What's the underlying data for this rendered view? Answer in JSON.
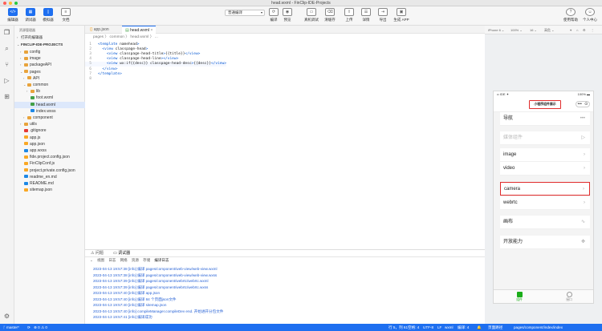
{
  "window": {
    "title": "head.wxml - FinClip-IDE-Projects"
  },
  "toolbar": {
    "left": [
      {
        "label": "编辑器",
        "icon": "code-icon"
      },
      {
        "label": "调试器",
        "icon": "debug-icon"
      },
      {
        "label": "模拟器",
        "icon": "phone-icon"
      },
      {
        "label": "文档",
        "icon": "doc-icon"
      }
    ],
    "compile_mode": "普通编译",
    "center": [
      {
        "label": "编译",
        "icon": "refresh-icon"
      },
      {
        "label": "预览",
        "icon": "eye-icon"
      }
    ],
    "right": [
      {
        "label": "真机调试",
        "icon": "device-icon"
      },
      {
        "label": "清缓存",
        "icon": "broom-icon"
      },
      {
        "label": "上传",
        "icon": "upload-icon"
      },
      {
        "label": "详情",
        "icon": "detail-icon"
      },
      {
        "label": "导出",
        "icon": "export-icon"
      },
      {
        "label": "生成 APP",
        "icon": "app-icon"
      }
    ],
    "help": [
      {
        "label": "使用帮助",
        "icon": "help-icon"
      },
      {
        "label": "个人中心",
        "icon": "user-icon"
      }
    ]
  },
  "explorer": {
    "title": "资源管理器",
    "open_editors": "打开的编辑器",
    "project": "FINCLIP-IDE-PROJECTS",
    "items": [
      {
        "label": "config",
        "type": "folder",
        "depth": 1,
        "chev": "›",
        "color": "#e8a33b"
      },
      {
        "label": "image",
        "type": "folder",
        "depth": 1,
        "chev": "›",
        "color": "#e8a33b"
      },
      {
        "label": "packageAPI",
        "type": "folder",
        "depth": 1,
        "chev": "›",
        "color": "#e8a33b"
      },
      {
        "label": "pages",
        "type": "folder",
        "depth": 1,
        "chev": "⌄",
        "color": "#e8a33b"
      },
      {
        "label": "API",
        "type": "folder",
        "depth": 2,
        "chev": "›",
        "color": "#e8a33b"
      },
      {
        "label": "common",
        "type": "folder",
        "depth": 2,
        "chev": "⌄",
        "color": "#e8a33b"
      },
      {
        "label": "lib",
        "type": "folder",
        "depth": 3,
        "chev": "›",
        "color": "#e8a33b"
      },
      {
        "label": "foot.wxml",
        "type": "file",
        "depth": 3,
        "chev": "",
        "color": "#43a047"
      },
      {
        "label": "head.wxml",
        "type": "file",
        "depth": 3,
        "chev": "",
        "color": "#43a047"
      },
      {
        "label": "index.wxss",
        "type": "file",
        "depth": 3,
        "chev": "",
        "color": "#1e88e5"
      },
      {
        "label": "component",
        "type": "folder",
        "depth": 2,
        "chev": "›",
        "color": "#e8a33b"
      },
      {
        "label": "utils",
        "type": "folder",
        "depth": 1,
        "chev": "›",
        "color": "#e8a33b"
      },
      {
        "label": ".gitignore",
        "type": "file",
        "depth": 1,
        "chev": "",
        "color": "#e53935"
      },
      {
        "label": "app.js",
        "type": "file",
        "depth": 1,
        "chev": "",
        "color": "#f9a825"
      },
      {
        "label": "app.json",
        "type": "file",
        "depth": 1,
        "chev": "",
        "color": "#f9a825"
      },
      {
        "label": "app.wxss",
        "type": "file",
        "depth": 1,
        "chev": "",
        "color": "#1e88e5"
      },
      {
        "label": "fide.project.config.json",
        "type": "file",
        "depth": 1,
        "chev": "",
        "color": "#f9a825"
      },
      {
        "label": "FinClipConf.js",
        "type": "file",
        "depth": 1,
        "chev": "",
        "color": "#f9a825"
      },
      {
        "label": "project.private.config.json",
        "type": "file",
        "depth": 1,
        "chev": "",
        "color": "#f9a825"
      },
      {
        "label": "readme_en.md",
        "type": "file",
        "depth": 1,
        "chev": "",
        "color": "#1e88e5"
      },
      {
        "label": "README.md",
        "type": "file",
        "depth": 1,
        "chev": "",
        "color": "#1e88e5"
      },
      {
        "label": "sitemap.json",
        "type": "file",
        "depth": 1,
        "chev": "",
        "color": "#f9a825"
      }
    ]
  },
  "editor": {
    "tabs": [
      {
        "label": "app.json",
        "active": false
      },
      {
        "label": "head.wxml",
        "active": true
      }
    ],
    "breadcrumb": "pages 〉 common 〉 head.wxml 〉 ...",
    "lines": [
      {
        "n": "1",
        "html": "<template name=\"head\">"
      },
      {
        "n": "2",
        "html": "  <view class=\"page-head\">"
      },
      {
        "n": "3",
        "html": "    <view class=\"page-head-title\">{{title}}</view>"
      },
      {
        "n": "4",
        "html": "    <view class=\"page-head-line\"></view>"
      },
      {
        "n": "5",
        "html": "    <view wx:if=\"{{desc}}\" class=\"page-head-desc\">{{desc}}</view>"
      },
      {
        "n": "6",
        "html": "  </view>"
      },
      {
        "n": "7",
        "html": "</template>"
      },
      {
        "n": "8",
        "html": ""
      }
    ]
  },
  "panel": {
    "tabs": [
      "问题",
      "调试器"
    ],
    "subtabs": [
      "视图",
      "日志",
      "网络",
      "资源",
      "存储",
      "编译日志"
    ],
    "logs": [
      "2023-04-13 19:57:38 [info] 编译 pages/component/web-view/web-view.wxml",
      "2023-04-13 19:57:38 [info] 编译 pages/component/web-view/web-view.wxss",
      "2023-04-13 19:57:39 [info] 编译 pages/component/webrtc/webrtc.wxml",
      "2023-04-13 19:57:39 [info] 编译 pages/component/webrtc/webrtc.wxss",
      "2023-04-13 19:57:40 [info] 编译 app.json",
      "2023-04-13 19:57:40 [info] 编译 84 个页面json文件",
      "2023-04-13 19:57:40 [info] 编译 sitemap.json",
      "2023-04-13 19:57:40 [info] compileManager.compileDev end. 开始进开分包文件",
      "2023-04-13 19:57:41 [info] 编译成功"
    ]
  },
  "simulator": {
    "device": "iPhone 6 ⌄",
    "zoom": "100% ⌄",
    "font": "16 ⌄",
    "net": "高危 ⌄",
    "status_left": "•• IDE ✦",
    "status_right": "100% ▬",
    "nav_title": "小程序组件展示",
    "capsule": [
      "•••",
      "⊙"
    ],
    "menu": [
      {
        "label": "导航",
        "dim": false,
        "hl": false,
        "right": "•••"
      },
      {
        "label": "媒体组件",
        "dim": true,
        "hl": false,
        "right": "▷"
      },
      {
        "label": "image",
        "dim": false,
        "hl": false,
        "right": "›"
      },
      {
        "label": "video",
        "dim": false,
        "hl": false,
        "right": "›"
      },
      {
        "label": "camera",
        "dim": false,
        "hl": true,
        "right": "›"
      },
      {
        "label": "webrtc",
        "dim": false,
        "hl": false,
        "right": "›"
      },
      {
        "label": "画布",
        "dim": false,
        "hl": false,
        "right": "∿"
      },
      {
        "label": "开放能力",
        "dim": false,
        "hl": false,
        "right": "✥"
      }
    ],
    "tabbar": [
      {
        "label": "组件",
        "active": true
      },
      {
        "label": "接口",
        "active": false
      }
    ],
    "page_path_label": "页面路径",
    "page_path": "pages/component/index/index"
  },
  "statusbar": {
    "branch": "ᚴ master*",
    "sync": "⟳",
    "problems": "⊗ 0 ⚠ 0",
    "cursor": "行 5，列 61",
    "spaces": "空格: 4",
    "encoding": "UTF-8",
    "eol": "LF",
    "lang": "wxml",
    "compile": "编译: 4",
    "notify": "🔔"
  },
  "colors": {
    "accent": "#1e6ff0",
    "highlight": "#e02b2b"
  }
}
